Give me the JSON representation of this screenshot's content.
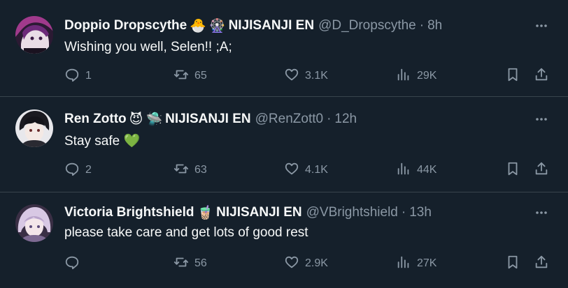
{
  "tweets": [
    {
      "display_name": "Doppio Dropscythe",
      "emojis": [
        "🐣",
        "🎡"
      ],
      "affiliation": "NIJISANJI EN",
      "handle": "@D_Dropscythe",
      "separator": "·",
      "time": "8h",
      "text": "Wishing you well, Selen!! ;A;",
      "replies": "1",
      "retweets": "65",
      "likes": "3.1K",
      "views": "29K",
      "avatar_colors": [
        "#5a2a6b",
        "#c43b8f",
        "#e8e8f0"
      ]
    },
    {
      "display_name": "Ren Zotto",
      "emojis": [
        "😈",
        "🛸"
      ],
      "affiliation": "NIJISANJI EN",
      "handle": "@RenZott0",
      "separator": "·",
      "time": "12h",
      "text": "Stay safe 💚",
      "replies": "2",
      "retweets": "63",
      "likes": "4.1K",
      "views": "44K",
      "avatar_colors": [
        "#1d1d24",
        "#f0e6e6",
        "#7a3a3a"
      ]
    },
    {
      "display_name": "Victoria Brightshield",
      "emojis": [
        "🧋"
      ],
      "affiliation": "NIJISANJI EN",
      "handle": "@VBrightshield",
      "separator": "·",
      "time": "13h",
      "text": "please take care and get lots of good rest",
      "replies": "",
      "retweets": "56",
      "likes": "2.9K",
      "views": "27K",
      "avatar_colors": [
        "#c9b6d6",
        "#8a6fa3",
        "#f1e8f2"
      ]
    }
  ],
  "colors": {
    "background": "#15202b",
    "primary_text": "#f7f9f9",
    "secondary_text": "#8b98a5",
    "divider": "#38444d"
  }
}
